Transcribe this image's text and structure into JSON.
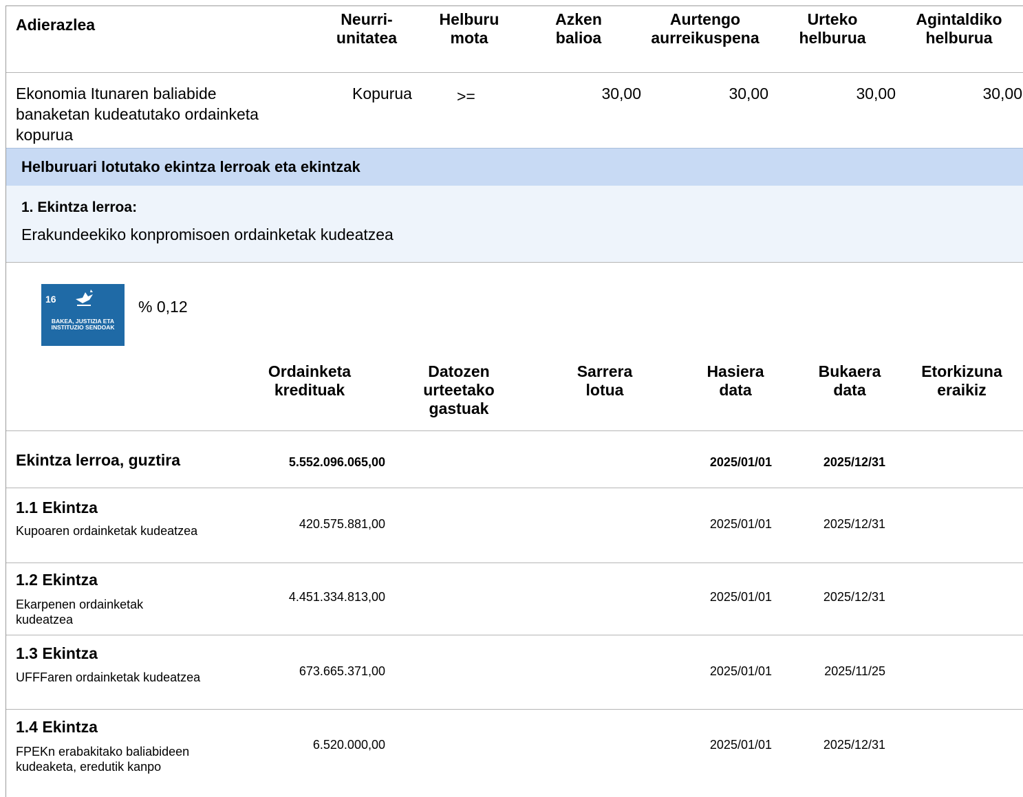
{
  "indicator_table": {
    "headers": {
      "indicator": "Adierazlea",
      "unit": "Neurri-\nunitatea",
      "target_type": "Helburu\nmota",
      "last_value": "Azken\nbalioa",
      "forecast": "Aurtengo\naurreikuspena",
      "annual_target": "Urteko\nhelburua",
      "term_target": "Agintaldiko\nhelburua"
    },
    "row": {
      "indicator": "Ekonomia Itunaren baliabide banaketan kudeatutako ordainketa kopurua",
      "unit": "Kopurua",
      "target_type": ">=",
      "last_value": "30,00",
      "forecast": "30,00",
      "annual_target": "30,00",
      "term_target": "30,00"
    }
  },
  "section_title": "Helburuari lotutako ekintza lerroak eta ekintzak",
  "action_line": {
    "title": "1. Ekintza lerroa:",
    "description": "Erakundeekiko konpromisoen ordainketak kudeatzea"
  },
  "sdg": {
    "number": "16",
    "icon": "dove-icon",
    "caption": "BAKEA, JUSTIZIA ETA INSTITUZIO SENDOAK",
    "color": "#1f6aa6",
    "percent": "% 0,12"
  },
  "actions_table": {
    "headers": {
      "credits": "Ordainketa\nkredituak",
      "future": "Datozen\nurteetako\ngastuak",
      "income": "Sarrera\nlotua",
      "start": "Hasiera\ndata",
      "end": "Bukaera\ndata",
      "future_build": "Etorkizuna\neraikiz"
    },
    "total": {
      "label": "Ekintza lerroa, guztira",
      "credits": "5.552.096.065,00",
      "start": "2025/01/01",
      "end": "2025/12/31"
    },
    "rows": [
      {
        "title": "1.1 Ekintza",
        "description": "Kupoaren ordainketak kudeatzea",
        "credits": "420.575.881,00",
        "start": "2025/01/01",
        "end": "2025/12/31"
      },
      {
        "title": "1.2 Ekintza",
        "description": "Ekarpenen ordainketak kudeatzea",
        "credits": "4.451.334.813,00",
        "start": "2025/01/01",
        "end": "2025/12/31"
      },
      {
        "title": "1.3 Ekintza",
        "description": "UFFFaren ordainketak kudeatzea",
        "credits": "673.665.371,00",
        "start": "2025/01/01",
        "end": "2025/11/25"
      },
      {
        "title": "1.4 Ekintza",
        "description": "FPEKn erabakitako baliabideen kudeaketa, eredutik kanpo",
        "credits": "6.520.000,00",
        "start": "2025/01/01",
        "end": "2025/12/31"
      }
    ]
  }
}
